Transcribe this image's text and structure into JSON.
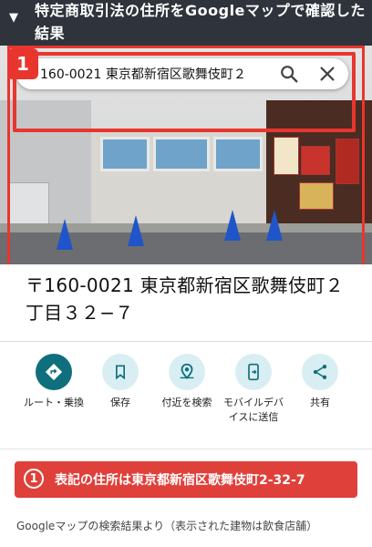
{
  "header": {
    "toggle_icon": "triangle-down-icon",
    "title": "特定商取引法の住所をGoogleマップで確認した結果"
  },
  "annotation_badge": "1",
  "search": {
    "query": "〒160-0021 東京都新宿区歌舞伎町２",
    "search_icon": "search-icon",
    "clear_icon": "close-icon"
  },
  "place": {
    "address": "〒160-0021 東京都新宿区歌舞伎町２丁目３２−７"
  },
  "actions": [
    {
      "label": "ルート・乗換",
      "icon": "directions-icon"
    },
    {
      "label": "保存",
      "icon": "bookmark-icon"
    },
    {
      "label": "付近を検索",
      "icon": "nearby-search-icon"
    },
    {
      "label": "モバイルデバイスに送信",
      "icon": "send-to-phone-icon"
    },
    {
      "label": "共有",
      "icon": "share-icon"
    }
  ],
  "callout": {
    "number": "1",
    "text": "表記の住所は東京都新宿区歌舞伎町2-32-7"
  },
  "caption": "Googleマップの検索結果より（表示された建物は飲食店舗）",
  "colors": {
    "accent_red": "#e8362f",
    "header_bg": "#2f333b",
    "teal": "#0f6f7c"
  }
}
